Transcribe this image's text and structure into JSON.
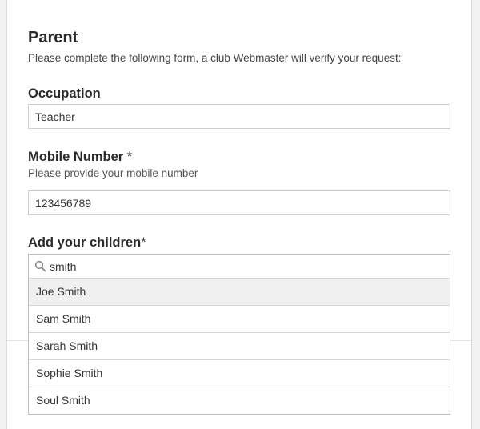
{
  "section": {
    "title": "Parent",
    "description": "Please complete the following form, a club Webmaster will verify your request:"
  },
  "occupation": {
    "label": "Occupation",
    "value": "Teacher"
  },
  "mobile": {
    "label": "Mobile Number",
    "required_mark": " *",
    "help": "Please provide your mobile number",
    "value": "123456789"
  },
  "children": {
    "label": "Add your children",
    "required_mark": "*",
    "search_value": "smith",
    "search_icon": "search-icon",
    "options": [
      {
        "label": "Joe Smith",
        "highlighted": true
      },
      {
        "label": "Sam Smith",
        "highlighted": false
      },
      {
        "label": "Sarah Smith",
        "highlighted": false
      },
      {
        "label": "Sophie Smith",
        "highlighted": false
      },
      {
        "label": "Soul Smith",
        "highlighted": false
      }
    ]
  },
  "colors": {
    "background": "#f1f1f1",
    "panel": "#ffffff",
    "highlight": "#f0f0f0",
    "border": "#cfcfcf"
  }
}
